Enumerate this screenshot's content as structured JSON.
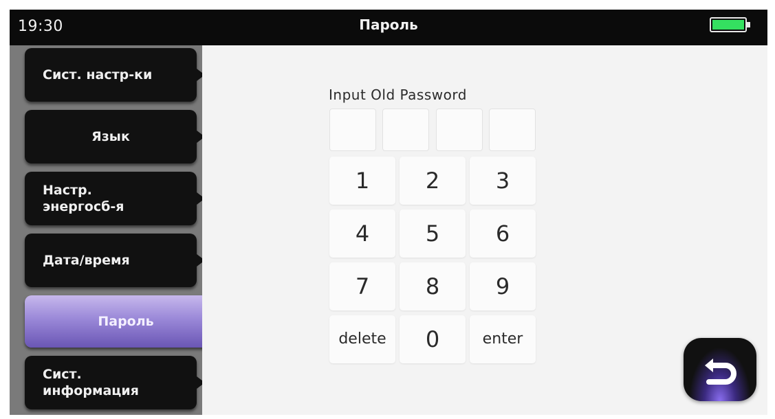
{
  "status_bar": {
    "time": "19:30",
    "title": "Пароль",
    "battery_icon": "battery-full-icon",
    "battery_color": "#34e060"
  },
  "sidebar": {
    "items": [
      {
        "label": "Сист. настр-ки",
        "active": false
      },
      {
        "label": "Язык",
        "active": false
      },
      {
        "label": "Настр. энергосб-я",
        "active": false
      },
      {
        "label": "Дата/время",
        "active": false
      },
      {
        "label": "Пароль",
        "active": true
      },
      {
        "label": "Сист. информация",
        "active": false
      }
    ],
    "active_color": "#9a88d8"
  },
  "password": {
    "prompt": "Input Old Password",
    "digits_entered": 0,
    "digit_slots": 4
  },
  "keypad": {
    "keys": [
      "1",
      "2",
      "3",
      "4",
      "5",
      "6",
      "7",
      "8",
      "9",
      "delete",
      "0",
      "enter"
    ]
  },
  "back_button": {
    "icon": "return-arrow-icon"
  }
}
